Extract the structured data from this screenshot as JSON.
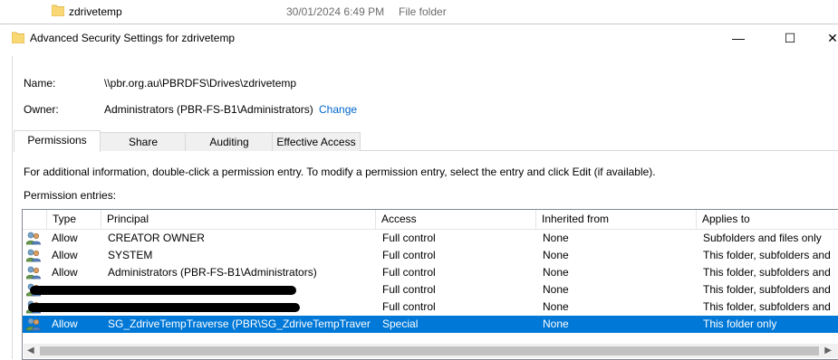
{
  "explorer": {
    "name": "zdrivetemp",
    "date": "30/01/2024 6:49 PM",
    "type": "File folder"
  },
  "window": {
    "title": "Advanced Security Settings for zdrivetemp",
    "minimize": "—",
    "maximize": "☐",
    "close": "✕"
  },
  "fields": {
    "name_label": "Name:",
    "name_value": "\\\\pbr.org.au\\PBRDFS\\Drives\\zdrivetemp",
    "owner_label": "Owner:",
    "owner_value": "Administrators (PBR-FS-B1\\Administrators)",
    "owner_change": "Change"
  },
  "tabs": [
    "Permissions",
    "Share",
    "Auditing",
    "Effective Access"
  ],
  "info_text": "For additional information, double-click a permission entry. To modify a permission entry, select the entry and click Edit (if available).",
  "entries_label": "Permission entries:",
  "columns": [
    "Type",
    "Principal",
    "Access",
    "Inherited from",
    "Applies to"
  ],
  "rows": [
    {
      "type": "Allow",
      "principal": "CREATOR OWNER",
      "access": "Full control",
      "inherited": "None",
      "applies": "Subfolders and files only",
      "redacted": false
    },
    {
      "type": "Allow",
      "principal": "SYSTEM",
      "access": "Full control",
      "inherited": "None",
      "applies": "This folder, subfolders and",
      "redacted": false
    },
    {
      "type": "Allow",
      "principal": "Administrators (PBR-FS-B1\\Administrators)",
      "access": "Full control",
      "inherited": "None",
      "applies": "This folder, subfolders and",
      "redacted": false
    },
    {
      "type": "",
      "principal": "",
      "access": "Full control",
      "inherited": "None",
      "applies": "This folder, subfolders and",
      "redacted": true
    },
    {
      "type": "",
      "principal": "",
      "access": "Full control",
      "inherited": "None",
      "applies": "This folder, subfolders and",
      "redacted": true
    },
    {
      "type": "Allow",
      "principal": "SG_ZdriveTempTraverse (PBR\\SG_ZdriveTempTraverse)",
      "access": "Special",
      "inherited": "None",
      "applies": "This folder only",
      "redacted": false,
      "selected": true
    }
  ],
  "colors": {
    "selection": "#0078d7",
    "link": "#0066cc"
  }
}
